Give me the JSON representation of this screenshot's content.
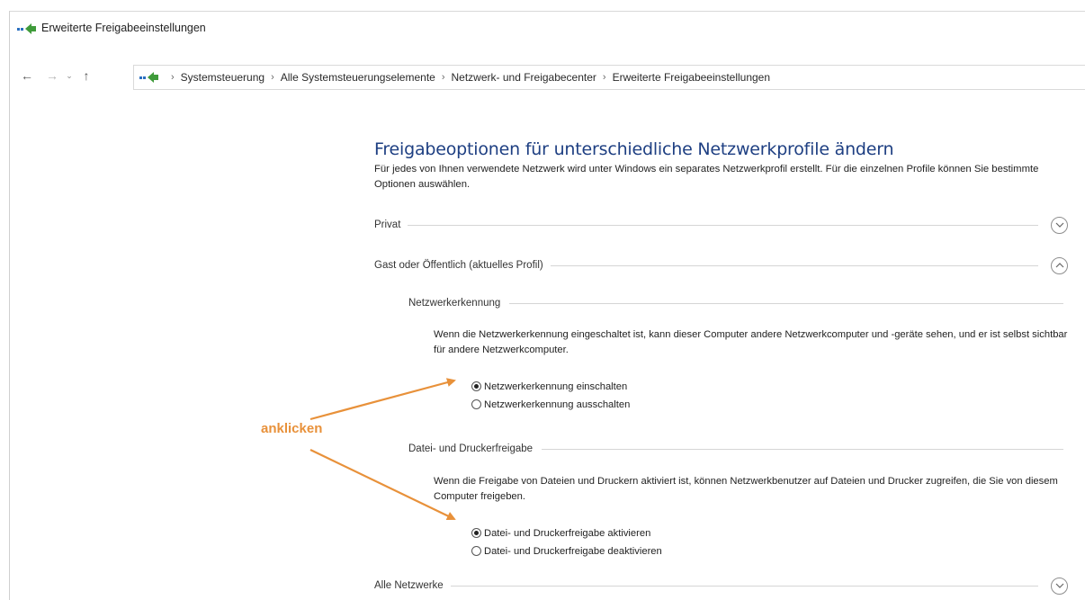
{
  "window": {
    "title": "Erweiterte Freigabeeinstellungen"
  },
  "nav": {
    "back": "←",
    "forward": "→",
    "recent": "⌄",
    "up": "↑",
    "breadcrumbs": [
      "Systemsteuerung",
      "Alle Systemsteuerungselemente",
      "Netzwerk- und Freigabecenter",
      "Erweiterte Freigabeeinstellungen"
    ],
    "separator": "›"
  },
  "main": {
    "headline": "Freigabeoptionen für unterschiedliche Netzwerkprofile ändern",
    "intro": "Für jedes von Ihnen verwendete Netzwerk wird unter Windows ein separates Netzwerkprofil erstellt. Für die einzelnen Profile können Sie bestimmte Optionen auswählen.",
    "profiles": {
      "private": {
        "label": "Privat",
        "expanded": false
      },
      "guest": {
        "label": "Gast oder Öffentlich (aktuelles Profil)",
        "expanded": true
      },
      "all": {
        "label": "Alle Netzwerke",
        "expanded": false
      }
    },
    "discovery": {
      "title": "Netzwerkerkennung",
      "description": "Wenn die Netzwerkerkennung eingeschaltet ist, kann dieser Computer andere Netzwerkcomputer und -geräte sehen, und er ist selbst sichtbar für andere Netzwerkcomputer.",
      "options": [
        "Netzwerkerkennung einschalten",
        "Netzwerkerkennung ausschalten"
      ],
      "selected": 0
    },
    "sharing": {
      "title": "Datei- und Druckerfreigabe",
      "description": "Wenn die Freigabe von Dateien und Druckern aktiviert ist, können Netzwerkbenutzer auf Dateien und Drucker zugreifen, die Sie von diesem Computer freigeben.",
      "options": [
        "Datei- und Druckerfreigabe aktivieren",
        "Datei- und Druckerfreigabe deaktivieren"
      ],
      "selected": 0
    }
  },
  "annotation": {
    "text": "anklicken",
    "color": "#e8913a"
  },
  "colors": {
    "headline": "#1e3f82",
    "icon_green": "#3f9b3a",
    "icon_blue": "#2a6fc0"
  }
}
